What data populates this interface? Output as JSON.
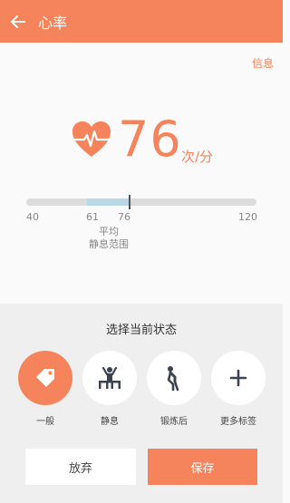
{
  "appbar": {
    "title": "心率"
  },
  "header": {
    "info_label": "信息"
  },
  "reading": {
    "value": "76",
    "unit": "次/分"
  },
  "range": {
    "min_label": "40",
    "max_label": "120",
    "avg_low": "61",
    "avg_high": "76",
    "avg_text": "平均",
    "rest_text": "静息范围",
    "scale_min": 40,
    "scale_max": 120,
    "fill_low": 61,
    "fill_high": 76,
    "marker": 76,
    "track_color": "#dcdcdc",
    "fill_color": "#b8d8e6"
  },
  "state": {
    "title": "选择当前状态",
    "options": [
      {
        "label": "一般",
        "icon": "tag-icon",
        "active": true
      },
      {
        "label": "静息",
        "icon": "resting-person-icon",
        "active": false
      },
      {
        "label": "锻炼后",
        "icon": "exercise-person-icon",
        "active": false
      },
      {
        "label": "更多标签",
        "icon": "plus-icon",
        "active": false
      }
    ]
  },
  "actions": {
    "cancel": "放弃",
    "save": "保存"
  },
  "colors": {
    "accent": "#f5845c"
  }
}
